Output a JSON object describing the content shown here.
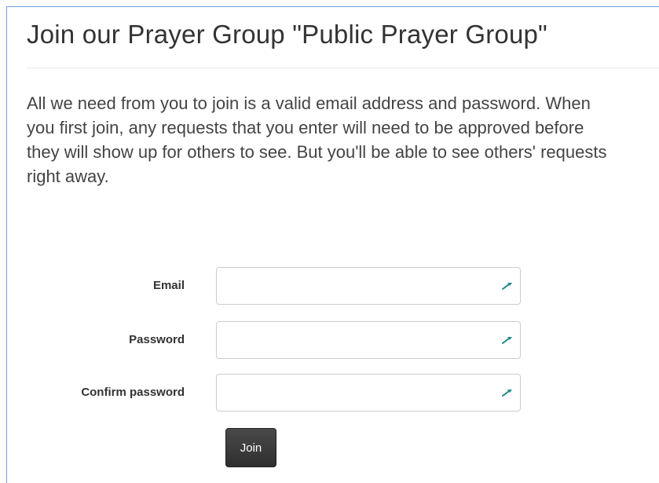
{
  "page": {
    "title": "Join our Prayer Group \"Public Prayer Group\"",
    "intro": "All we need from you to join is a valid email address and password. When you first join, any requests that you enter will need to be approved before they will show up for others to see. But you'll be able to see others' requests right away."
  },
  "form": {
    "email": {
      "label": "Email",
      "value": "",
      "icon": "password-manager-key-icon"
    },
    "password": {
      "label": "Password",
      "value": "",
      "icon": "password-manager-key-icon"
    },
    "confirm_password": {
      "label": "Confirm password",
      "value": "",
      "icon": "password-manager-key-icon"
    },
    "join_label": "Join"
  },
  "colors": {
    "frame_border": "#6fa0d8",
    "button_bg": "#3a3a3a",
    "icon_teal": "#1f8a8a"
  }
}
